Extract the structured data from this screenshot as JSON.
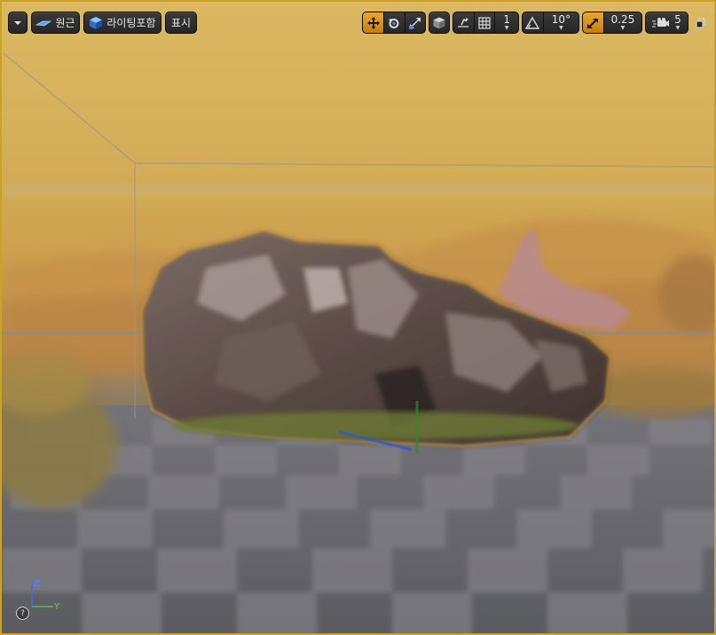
{
  "toolbar": {
    "perspective_label": "원근",
    "lighting_label": "라이팅포함",
    "show_label": "표시",
    "grid_snap_value": "1",
    "rotation_snap_value": "10°",
    "scale_snap_value": "0.25",
    "camera_speed_value": "5"
  },
  "axes": {
    "x": "X",
    "y": "Y",
    "z": "Z"
  },
  "help": {
    "label": "?"
  },
  "colors": {
    "accent": "#e8a52b",
    "viewport_border": "#c9a227",
    "button_bg": "#2e2e2e"
  },
  "icons": {
    "dropdown": "chevron-down-icon",
    "perspective": "perspective-icon",
    "lighting": "lit-cube-icon",
    "translate": "translate-icon",
    "rotate": "rotate-icon",
    "scale": "scale-icon",
    "coordinate": "world-cube-icon",
    "surface_snap": "surface-snap-icon",
    "grid_snap": "grid-icon",
    "rotation_snap": "angle-icon",
    "scale_snap": "scale-snap-icon",
    "camera_speed": "camera-icon",
    "restore": "restore-window-icon"
  }
}
